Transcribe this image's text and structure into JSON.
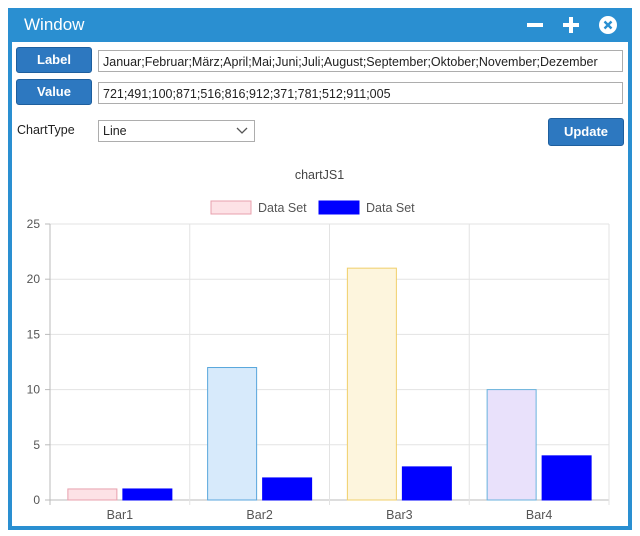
{
  "window": {
    "title": "Window"
  },
  "form": {
    "label_button": "Label",
    "value_button": "Value",
    "label_value": "Januar;Februar;März;April;Mai;Juni;Juli;August;September;Oktober;November;Dezember",
    "value_value": "721;491;100;871;516;816;912;371;781;512;911;005",
    "charttype_label": "ChartType",
    "charttype_selected": "Line",
    "update_button": "Update"
  },
  "colors": {
    "titlebar": "#2a8fd1",
    "button": "#2d78c0"
  },
  "chart_data": {
    "type": "bar",
    "title": "chartJS1",
    "categories": [
      "Bar1",
      "Bar2",
      "Bar3",
      "Bar4"
    ],
    "ylim": [
      0,
      25
    ],
    "yticks": [
      "0",
      "5",
      "10",
      "15",
      "20",
      "25"
    ],
    "grid": true,
    "legend_position": "top",
    "series": [
      {
        "name": "Data Set",
        "values": [
          1,
          12,
          21,
          10
        ],
        "fills": [
          "#fde2e6",
          "#d7eafb",
          "#fdf5dd",
          "#e9e1fb"
        ],
        "strokes": [
          "#e8a0ae",
          "#58a6dc",
          "#f0cf6a",
          "#69b2dd"
        ]
      },
      {
        "name": "Data Set",
        "values": [
          1,
          2,
          3,
          4
        ],
        "fills": [
          "#0000ff",
          "#0000ff",
          "#0000ff",
          "#0000ff"
        ],
        "strokes": [
          "#0000ff",
          "#0000ff",
          "#0000ff",
          "#0000ff"
        ]
      }
    ]
  }
}
